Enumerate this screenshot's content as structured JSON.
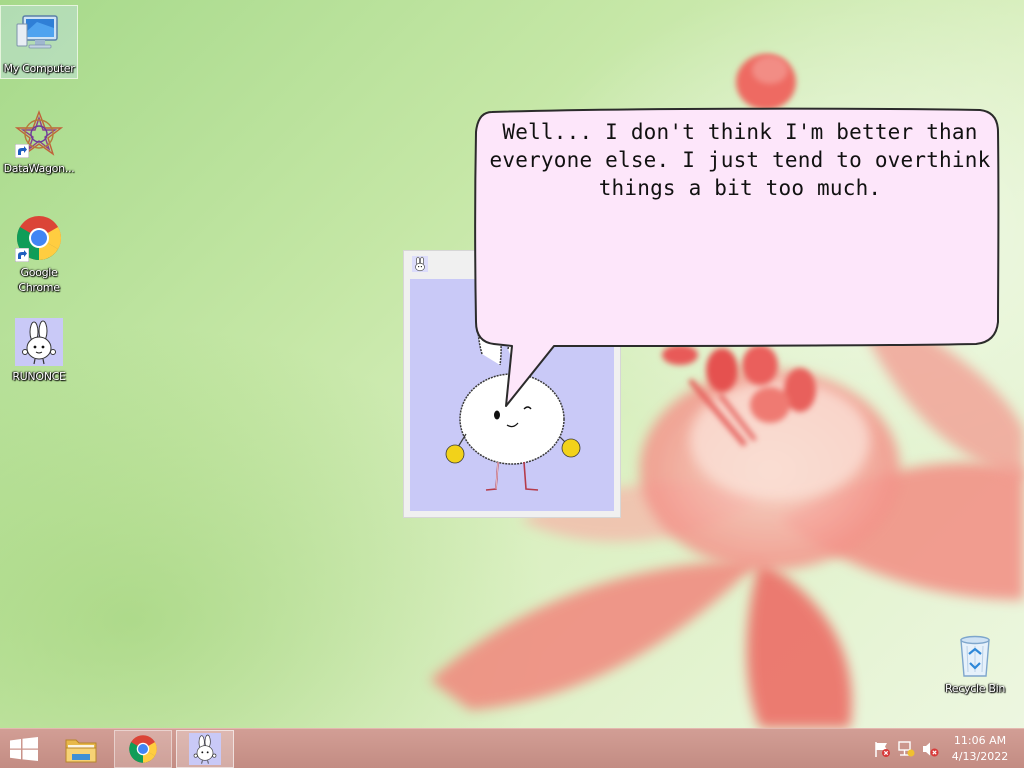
{
  "desktop": {
    "icons": [
      {
        "label": "My Computer",
        "icon": "computer-icon"
      },
      {
        "label": "DataWagon...",
        "icon": "datawagon-icon"
      },
      {
        "label": "Google Chrome",
        "icon": "chrome-icon"
      },
      {
        "label": "RUNONCE",
        "icon": "bunny-icon"
      },
      {
        "label": "Recycle Bin",
        "icon": "recycle-bin-icon"
      }
    ]
  },
  "pet_window": {
    "icon": "bunny-icon",
    "speech": "Well... I don't think I'm better than everyone else. I just tend to overthink things a bit too much.",
    "colors": {
      "pet_background": "#c9c9f7",
      "bubble_fill": "#fde6fa",
      "bunny_hands": "#f2d21a"
    }
  },
  "taskbar": {
    "items": [
      {
        "name": "Start",
        "icon": "windows-logo-icon"
      },
      {
        "name": "File Explorer",
        "icon": "folder-icon"
      },
      {
        "name": "Google Chrome",
        "icon": "chrome-icon"
      },
      {
        "name": "RUNONCE",
        "icon": "bunny-icon"
      }
    ],
    "tray": {
      "icons": [
        "action-center-flag-icon",
        "network-icon",
        "volume-muted-icon"
      ],
      "time": "11:06 AM",
      "date": "4/13/2022"
    },
    "colors": {
      "taskbar": "#c8928a"
    }
  }
}
